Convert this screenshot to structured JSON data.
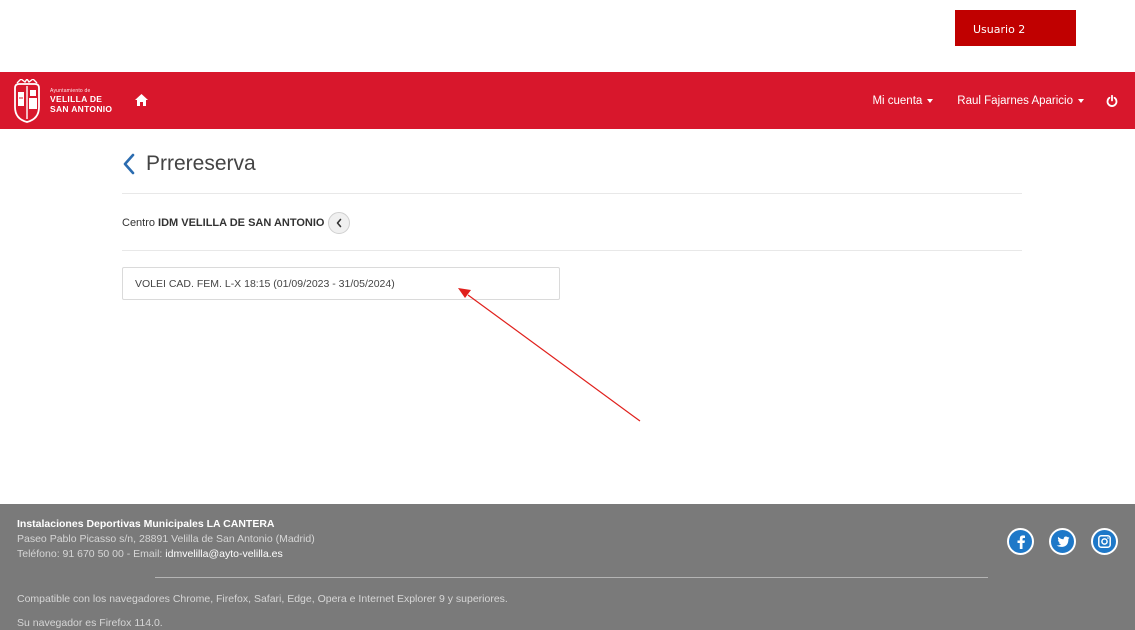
{
  "user_badge": "Usuario 2",
  "brand": {
    "small": "Ayuntamiento de",
    "line1": "VELILLA DE",
    "line2": "SAN ANTONIO",
    "color": "#d8172c"
  },
  "nav": {
    "account": "Mi cuenta",
    "user": "Raul Fajarnes Aparicio"
  },
  "page": {
    "title": "Prrereserva",
    "center_label": "Centro",
    "center_name": "IDM VELILLA DE SAN ANTONIO",
    "activity": "VOLEI CAD. FEM. L-X 18:15 (01/09/2023 - 31/05/2024)"
  },
  "footer": {
    "title": "Instalaciones Deportivas Municipales LA CANTERA",
    "address": "Paseo Pablo Picasso s/n, 28891 Velilla de San Antonio (Madrid)",
    "phone_prefix": "Teléfono: 91 670 50 00 - Email:",
    "email": "idmvelilla@ayto-velilla.es",
    "compat": "Compatible con los navegadores Chrome, Firefox, Safari, Edge, Opera e Internet Explorer 9 y superiores.",
    "browser": "Su navegador es Firefox 114.0."
  },
  "social": [
    "facebook-icon",
    "twitter-icon",
    "instagram-icon"
  ],
  "colors": {
    "accent": "#d8172c",
    "badge": "#c00000",
    "footer": "#7a7a7a",
    "link": "#1f5fa8"
  }
}
